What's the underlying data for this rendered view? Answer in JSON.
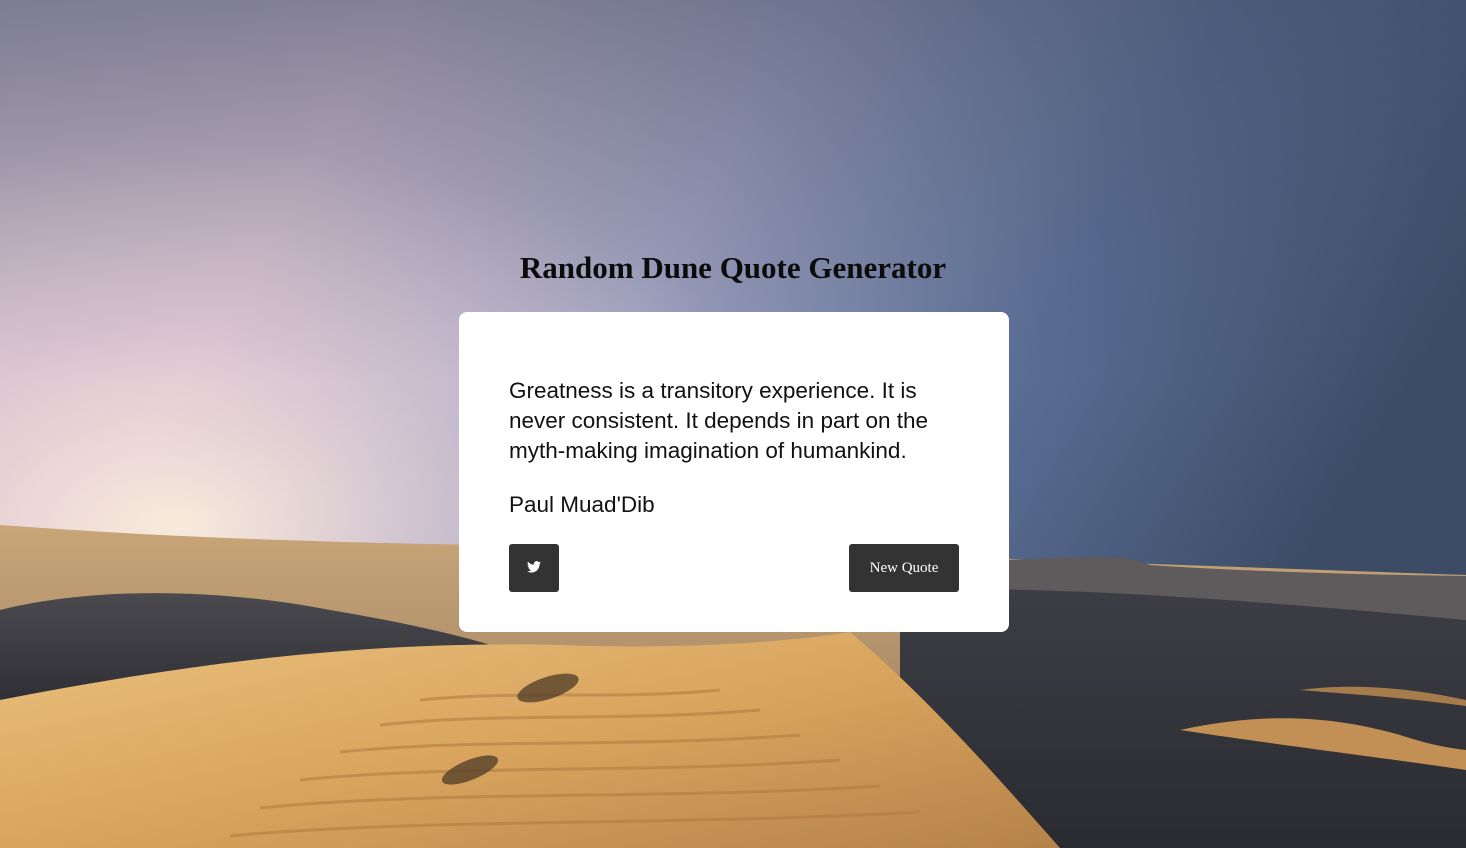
{
  "page": {
    "title": "Random Dune Quote Generator"
  },
  "quote": {
    "text": "Greatness is a transitory experience. It is never consistent. It depends in part on the myth-making imagination of humankind.",
    "author": "Paul Muad'Dib"
  },
  "buttons": {
    "tweet_icon": "twitter-icon",
    "new_quote_label": "New Quote"
  },
  "colors": {
    "card_background": "#ffffff",
    "button_background": "#333333",
    "button_text": "#ffffff",
    "title_text": "#0b0b0b"
  }
}
